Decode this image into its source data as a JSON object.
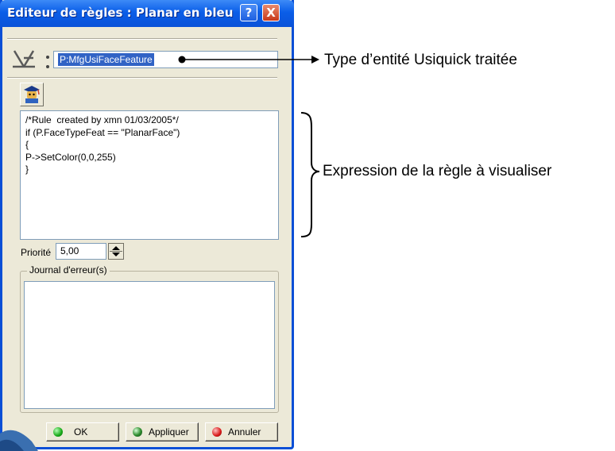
{
  "dialog": {
    "title": "Editeur de règles : Planar en bleu",
    "help_label": "?",
    "close_label": "X",
    "feature_value": "P:MfgUsiFaceFeature",
    "code_lines": [
      "/*Rule  created by xmn 01/03/2005*/",
      "if (P.FaceTypeFeat == \"PlanarFace\")",
      "{",
      "P->SetColor(0,0,255)",
      "}"
    ],
    "priority_label": "Priorité",
    "priority_value": "5,00",
    "journal_label": "Journal d'erreur(s)",
    "buttons": {
      "ok": "OK",
      "apply": "Appliquer",
      "cancel": "Annuler"
    }
  },
  "annotations": {
    "type_note": "Type d’entité Usiquick traitée",
    "expression_note": "Expression de la règle à visualiser"
  },
  "colors": {
    "titlebar": "#0a5ee8",
    "dialog_bg": "#ece9d8",
    "selection": "#3163c5"
  },
  "icons": {
    "feature_symbol": "planar-face-symbol-icon",
    "rule_button": "rule-wizard-icon",
    "spinner": "spinner-arrows-icon"
  }
}
